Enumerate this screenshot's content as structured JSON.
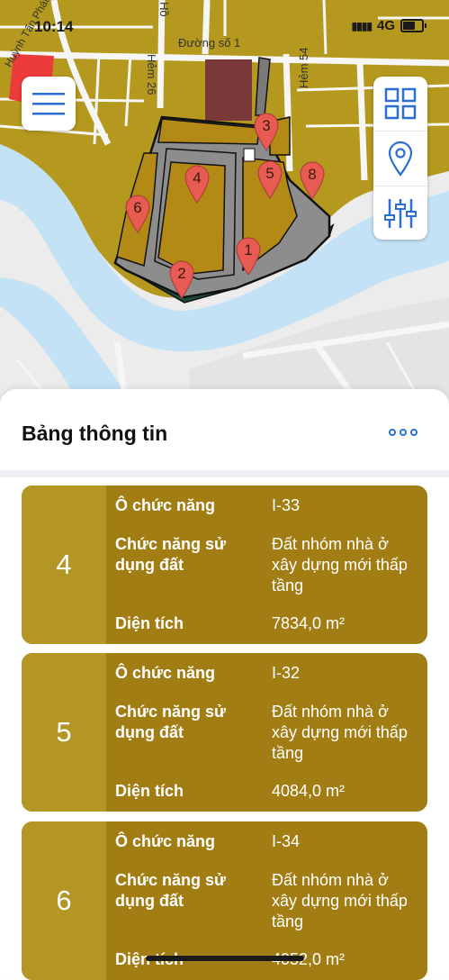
{
  "status_bar": {
    "time": "10:14",
    "network": "4G"
  },
  "map": {
    "street_labels": [
      "Đường số 1",
      "Hẻm 26",
      "Hẻm 54",
      "Hồ",
      "Huỳnh Tấn Phát"
    ],
    "pins": [
      "1",
      "2",
      "3",
      "4",
      "5",
      "6",
      "8"
    ],
    "colors": {
      "land": "#b5991e",
      "river": "#c4e2f5",
      "road": "#f4f4f4",
      "parcel": "#a47f12",
      "pin": "#e85b53"
    }
  },
  "buttons": {
    "menu": "hamburger-icon",
    "grid": "grid-icon",
    "location": "location-pin-icon",
    "filters": "sliders-icon"
  },
  "sheet": {
    "title": "Bảng thông tin",
    "more": "more-icon"
  },
  "cards": [
    {
      "index": "4",
      "function_code_label": "Ô chức năng",
      "function_code": "I-33",
      "land_use_label": "Chức năng sử dụng đất",
      "land_use": "Đất nhóm nhà ở xây dựng mới thấp tầng",
      "area_label": "Diện tích",
      "area": "7834,0 m²"
    },
    {
      "index": "5",
      "function_code_label": "Ô chức năng",
      "function_code": "I-32",
      "land_use_label": "Chức năng sử dụng đất",
      "land_use": "Đất nhóm nhà ở xây dựng mới thấp tầng",
      "area_label": "Diện tích",
      "area": "4084,0 m²"
    },
    {
      "index": "6",
      "function_code_label": "Ô chức năng",
      "function_code": "I-34",
      "land_use_label": "Chức năng sử dụng đất",
      "land_use": "Đất nhóm nhà ở xây dựng mới thấp tầng",
      "area_label": "Diện tích",
      "area": "4052,0 m²"
    }
  ]
}
